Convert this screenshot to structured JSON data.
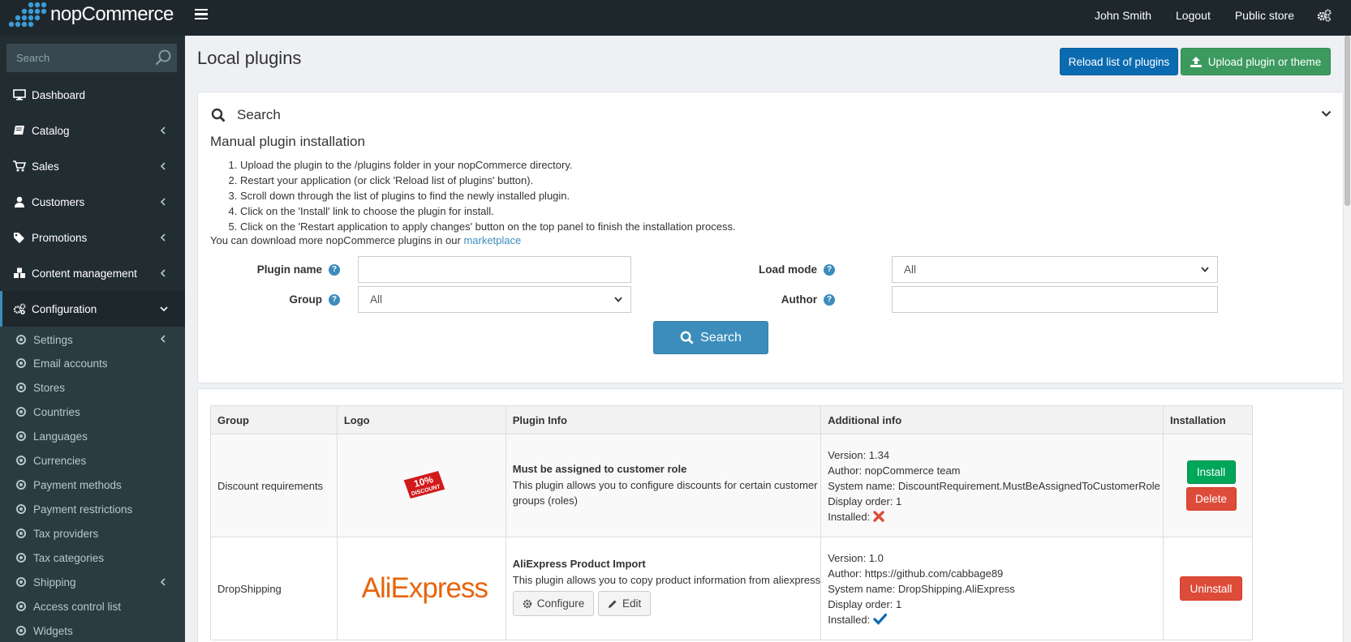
{
  "brand": {
    "name": "nopCommerce"
  },
  "topnav": {
    "user": "John Smith",
    "logout": "Logout",
    "public_store": "Public store"
  },
  "sidebar": {
    "search_placeholder": "Search",
    "items": [
      {
        "label": "Dashboard",
        "icon": "desktop-icon"
      },
      {
        "label": "Catalog",
        "icon": "book-icon"
      },
      {
        "label": "Sales",
        "icon": "cart-icon"
      },
      {
        "label": "Customers",
        "icon": "user-icon"
      },
      {
        "label": "Promotions",
        "icon": "tags-icon"
      },
      {
        "label": "Content management",
        "icon": "cubes-icon"
      },
      {
        "label": "Configuration",
        "icon": "gears-icon"
      }
    ],
    "config_items": [
      "Settings",
      "Email accounts",
      "Stores",
      "Countries",
      "Languages",
      "Currencies",
      "Payment methods",
      "Payment restrictions",
      "Tax providers",
      "Tax categories",
      "Shipping",
      "Access control list",
      "Widgets"
    ]
  },
  "page": {
    "title": "Local plugins",
    "reload_button": "Reload list of plugins",
    "upload_button": "Upload plugin or theme"
  },
  "search": {
    "title": "Search",
    "manual_title": "Manual plugin installation",
    "steps": [
      "Upload the plugin to the /plugins folder in your nopCommerce directory.",
      "Restart your application (or click 'Reload list of plugins' button).",
      "Scroll down through the list of plugins to find the newly installed plugin.",
      "Click on the 'Install' link to choose the plugin for install.",
      "Click on the 'Restart application to apply changes' button on the top panel to finish the installation process."
    ],
    "more_text": "You can download more nopCommerce plugins in our ",
    "more_link": "marketplace",
    "plugin_name_label": "Plugin name",
    "plugin_name_value": "",
    "group_label": "Group",
    "group_value": "All",
    "load_mode_label": "Load mode",
    "load_mode_value": "All",
    "author_label": "Author",
    "author_value": "",
    "search_button": "Search"
  },
  "table": {
    "headers": [
      "Group",
      "Logo",
      "Plugin Info",
      "Additional info",
      "Installation"
    ],
    "rows": [
      {
        "group": "Discount requirements",
        "logo_text": "10% DISCOUNT",
        "name": "Must be assigned to customer role",
        "description": "This plugin allows you to configure discounts for certain customer groups (roles)",
        "version": "Version: 1.34",
        "author": "Author: nopCommerce team",
        "system_name": "System name: DiscountRequirement.MustBeAssignedToCustomerRole",
        "display_order": "Display order: 1",
        "installed_label": "Installed:",
        "install_button": "Install",
        "delete_button": "Delete"
      },
      {
        "group": "DropShipping",
        "logo_text": "AliExpress",
        "name": "AliExpress Product Import",
        "description": "This plugin allows you to copy product information from aliexpress",
        "configure_button": "Configure",
        "edit_button": "Edit",
        "version": "Version: 1.0",
        "author": "Author: https://github.com/cabbage89",
        "system_name": "System name: DropShipping.AliExpress",
        "display_order": "Display order: 1",
        "installed_label": "Installed:",
        "uninstall_button": "Uninstall"
      }
    ]
  },
  "colors": {
    "topbar": "#1e282c",
    "sidebar": "#222d32",
    "primary": "#3c8dbc",
    "reload": "#0b6bb0",
    "upload": "#3c9a5f",
    "install": "#00a65a",
    "danger": "#dd4b39"
  }
}
